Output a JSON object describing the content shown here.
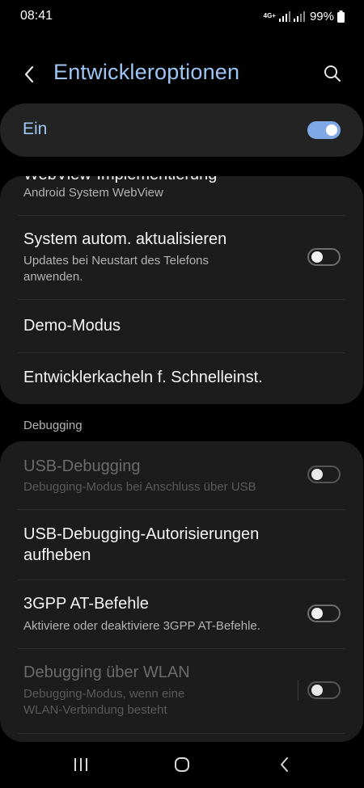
{
  "status_bar": {
    "time": "08:41",
    "network_type": "4G+",
    "battery": "99%"
  },
  "header": {
    "title": "Entwickleroptionen",
    "back_icon": "chevron-left-icon",
    "search_icon": "search-icon"
  },
  "master_switch": {
    "label": "Ein",
    "on": true
  },
  "sections": [
    {
      "items": [
        {
          "title": "WebView-Implementierung",
          "summary": "Android System WebView"
        },
        {
          "title": "System autom. aktualisieren",
          "summary": "Updates bei Neustart des Telefons anwenden.",
          "switch": false
        },
        {
          "title": "Demo-Modus"
        },
        {
          "title": "Entwicklerkacheln f. Schnelleinst."
        }
      ]
    },
    {
      "header": "Debugging",
      "items": [
        {
          "title": "USB-Debugging",
          "summary": "Debugging-Modus bei Anschluss über USB",
          "switch": false,
          "disabled": true
        },
        {
          "title": "USB-Debugging-Autorisierungen aufheben"
        },
        {
          "title": "3GPP AT-Befehle",
          "summary": "Aktiviere oder deaktiviere 3GPP AT-Befehle.",
          "switch": false
        },
        {
          "title": "Debugging über WLAN",
          "summary": "Debugging-Modus, wenn eine WLAN-Verbindung besteht",
          "switch": false,
          "disabled": true
        }
      ]
    }
  ],
  "nav_bar": {
    "recents_icon": "recents-icon",
    "home_icon": "home-icon",
    "back_icon": "back-icon"
  },
  "colors": {
    "accent": "#9ec6f5",
    "switch_on": "#7fa8e6",
    "background": "#000000",
    "card": "#1c1c1c"
  }
}
